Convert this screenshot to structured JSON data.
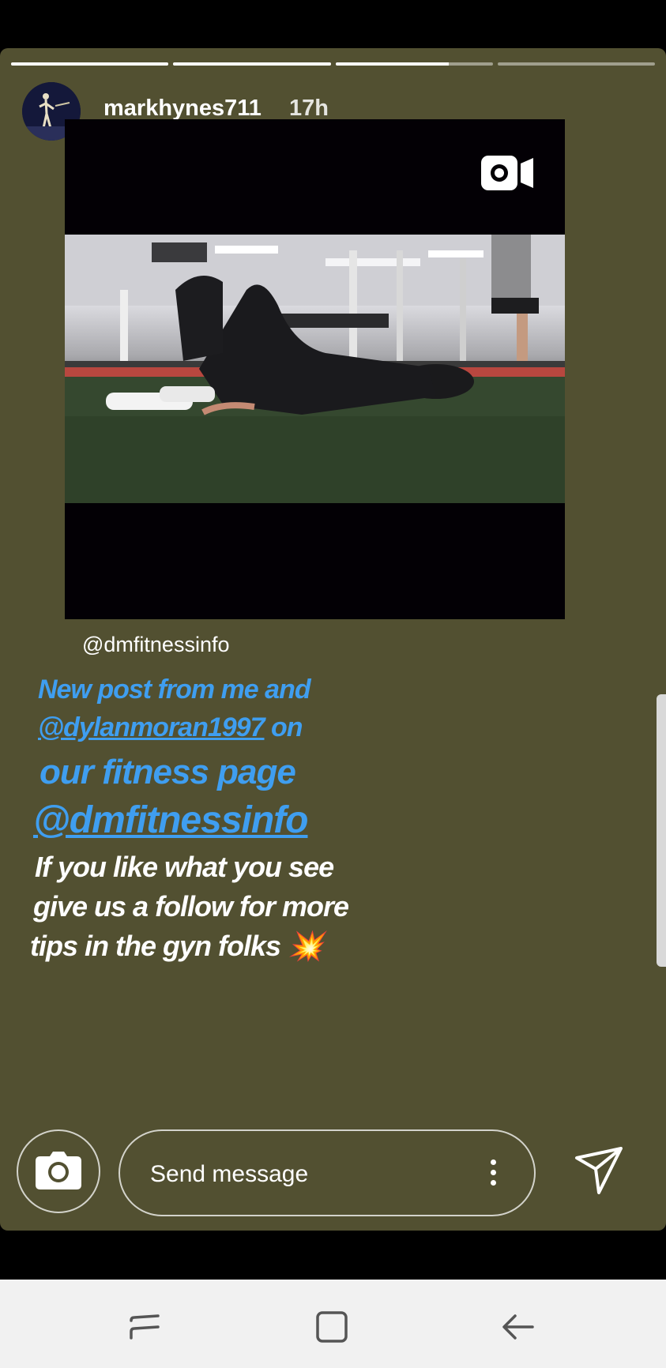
{
  "story": {
    "segments": [
      1,
      1,
      0.72,
      0
    ],
    "username": "markhynes711",
    "time_ago": "17h",
    "shared_tag": "@dmfitnessinfo",
    "caption_blue": {
      "line1": "New post from me and",
      "line2_mention": "@dylanmoran1997",
      "line2_rest": " on",
      "line3": "our fitness page",
      "line4": "@dmfitnessinfo"
    },
    "caption_white": {
      "line1": "If you like what you see",
      "line2": "give us a follow for more",
      "line3": "tips in the gyn folks",
      "emoji": "💥"
    }
  },
  "reply_bar": {
    "message_placeholder": "Send message"
  },
  "colors": {
    "background": "#525031",
    "caption_blue": "#3f9ef0"
  },
  "icons": {
    "video": "video-camera-icon",
    "camera": "camera-icon",
    "more": "more-vertical-icon",
    "send": "send-icon",
    "recents": "recents-icon",
    "home": "home-icon",
    "back": "back-icon"
  }
}
